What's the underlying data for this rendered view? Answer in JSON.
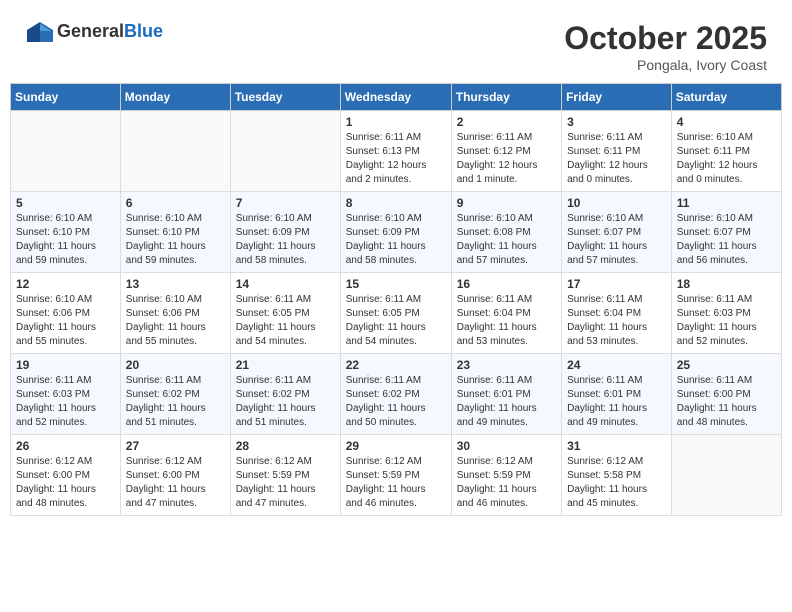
{
  "header": {
    "logo_line1": "General",
    "logo_line2": "Blue",
    "month": "October 2025",
    "location": "Pongala, Ivory Coast"
  },
  "weekdays": [
    "Sunday",
    "Monday",
    "Tuesday",
    "Wednesday",
    "Thursday",
    "Friday",
    "Saturday"
  ],
  "weeks": [
    [
      {
        "day": "",
        "info": ""
      },
      {
        "day": "",
        "info": ""
      },
      {
        "day": "",
        "info": ""
      },
      {
        "day": "1",
        "info": "Sunrise: 6:11 AM\nSunset: 6:13 PM\nDaylight: 12 hours\nand 2 minutes."
      },
      {
        "day": "2",
        "info": "Sunrise: 6:11 AM\nSunset: 6:12 PM\nDaylight: 12 hours\nand 1 minute."
      },
      {
        "day": "3",
        "info": "Sunrise: 6:11 AM\nSunset: 6:11 PM\nDaylight: 12 hours\nand 0 minutes."
      },
      {
        "day": "4",
        "info": "Sunrise: 6:10 AM\nSunset: 6:11 PM\nDaylight: 12 hours\nand 0 minutes."
      }
    ],
    [
      {
        "day": "5",
        "info": "Sunrise: 6:10 AM\nSunset: 6:10 PM\nDaylight: 11 hours\nand 59 minutes."
      },
      {
        "day": "6",
        "info": "Sunrise: 6:10 AM\nSunset: 6:10 PM\nDaylight: 11 hours\nand 59 minutes."
      },
      {
        "day": "7",
        "info": "Sunrise: 6:10 AM\nSunset: 6:09 PM\nDaylight: 11 hours\nand 58 minutes."
      },
      {
        "day": "8",
        "info": "Sunrise: 6:10 AM\nSunset: 6:09 PM\nDaylight: 11 hours\nand 58 minutes."
      },
      {
        "day": "9",
        "info": "Sunrise: 6:10 AM\nSunset: 6:08 PM\nDaylight: 11 hours\nand 57 minutes."
      },
      {
        "day": "10",
        "info": "Sunrise: 6:10 AM\nSunset: 6:07 PM\nDaylight: 11 hours\nand 57 minutes."
      },
      {
        "day": "11",
        "info": "Sunrise: 6:10 AM\nSunset: 6:07 PM\nDaylight: 11 hours\nand 56 minutes."
      }
    ],
    [
      {
        "day": "12",
        "info": "Sunrise: 6:10 AM\nSunset: 6:06 PM\nDaylight: 11 hours\nand 55 minutes."
      },
      {
        "day": "13",
        "info": "Sunrise: 6:10 AM\nSunset: 6:06 PM\nDaylight: 11 hours\nand 55 minutes."
      },
      {
        "day": "14",
        "info": "Sunrise: 6:11 AM\nSunset: 6:05 PM\nDaylight: 11 hours\nand 54 minutes."
      },
      {
        "day": "15",
        "info": "Sunrise: 6:11 AM\nSunset: 6:05 PM\nDaylight: 11 hours\nand 54 minutes."
      },
      {
        "day": "16",
        "info": "Sunrise: 6:11 AM\nSunset: 6:04 PM\nDaylight: 11 hours\nand 53 minutes."
      },
      {
        "day": "17",
        "info": "Sunrise: 6:11 AM\nSunset: 6:04 PM\nDaylight: 11 hours\nand 53 minutes."
      },
      {
        "day": "18",
        "info": "Sunrise: 6:11 AM\nSunset: 6:03 PM\nDaylight: 11 hours\nand 52 minutes."
      }
    ],
    [
      {
        "day": "19",
        "info": "Sunrise: 6:11 AM\nSunset: 6:03 PM\nDaylight: 11 hours\nand 52 minutes."
      },
      {
        "day": "20",
        "info": "Sunrise: 6:11 AM\nSunset: 6:02 PM\nDaylight: 11 hours\nand 51 minutes."
      },
      {
        "day": "21",
        "info": "Sunrise: 6:11 AM\nSunset: 6:02 PM\nDaylight: 11 hours\nand 51 minutes."
      },
      {
        "day": "22",
        "info": "Sunrise: 6:11 AM\nSunset: 6:02 PM\nDaylight: 11 hours\nand 50 minutes."
      },
      {
        "day": "23",
        "info": "Sunrise: 6:11 AM\nSunset: 6:01 PM\nDaylight: 11 hours\nand 49 minutes."
      },
      {
        "day": "24",
        "info": "Sunrise: 6:11 AM\nSunset: 6:01 PM\nDaylight: 11 hours\nand 49 minutes."
      },
      {
        "day": "25",
        "info": "Sunrise: 6:11 AM\nSunset: 6:00 PM\nDaylight: 11 hours\nand 48 minutes."
      }
    ],
    [
      {
        "day": "26",
        "info": "Sunrise: 6:12 AM\nSunset: 6:00 PM\nDaylight: 11 hours\nand 48 minutes."
      },
      {
        "day": "27",
        "info": "Sunrise: 6:12 AM\nSunset: 6:00 PM\nDaylight: 11 hours\nand 47 minutes."
      },
      {
        "day": "28",
        "info": "Sunrise: 6:12 AM\nSunset: 5:59 PM\nDaylight: 11 hours\nand 47 minutes."
      },
      {
        "day": "29",
        "info": "Sunrise: 6:12 AM\nSunset: 5:59 PM\nDaylight: 11 hours\nand 46 minutes."
      },
      {
        "day": "30",
        "info": "Sunrise: 6:12 AM\nSunset: 5:59 PM\nDaylight: 11 hours\nand 46 minutes."
      },
      {
        "day": "31",
        "info": "Sunrise: 6:12 AM\nSunset: 5:58 PM\nDaylight: 11 hours\nand 45 minutes."
      },
      {
        "day": "",
        "info": ""
      }
    ]
  ]
}
